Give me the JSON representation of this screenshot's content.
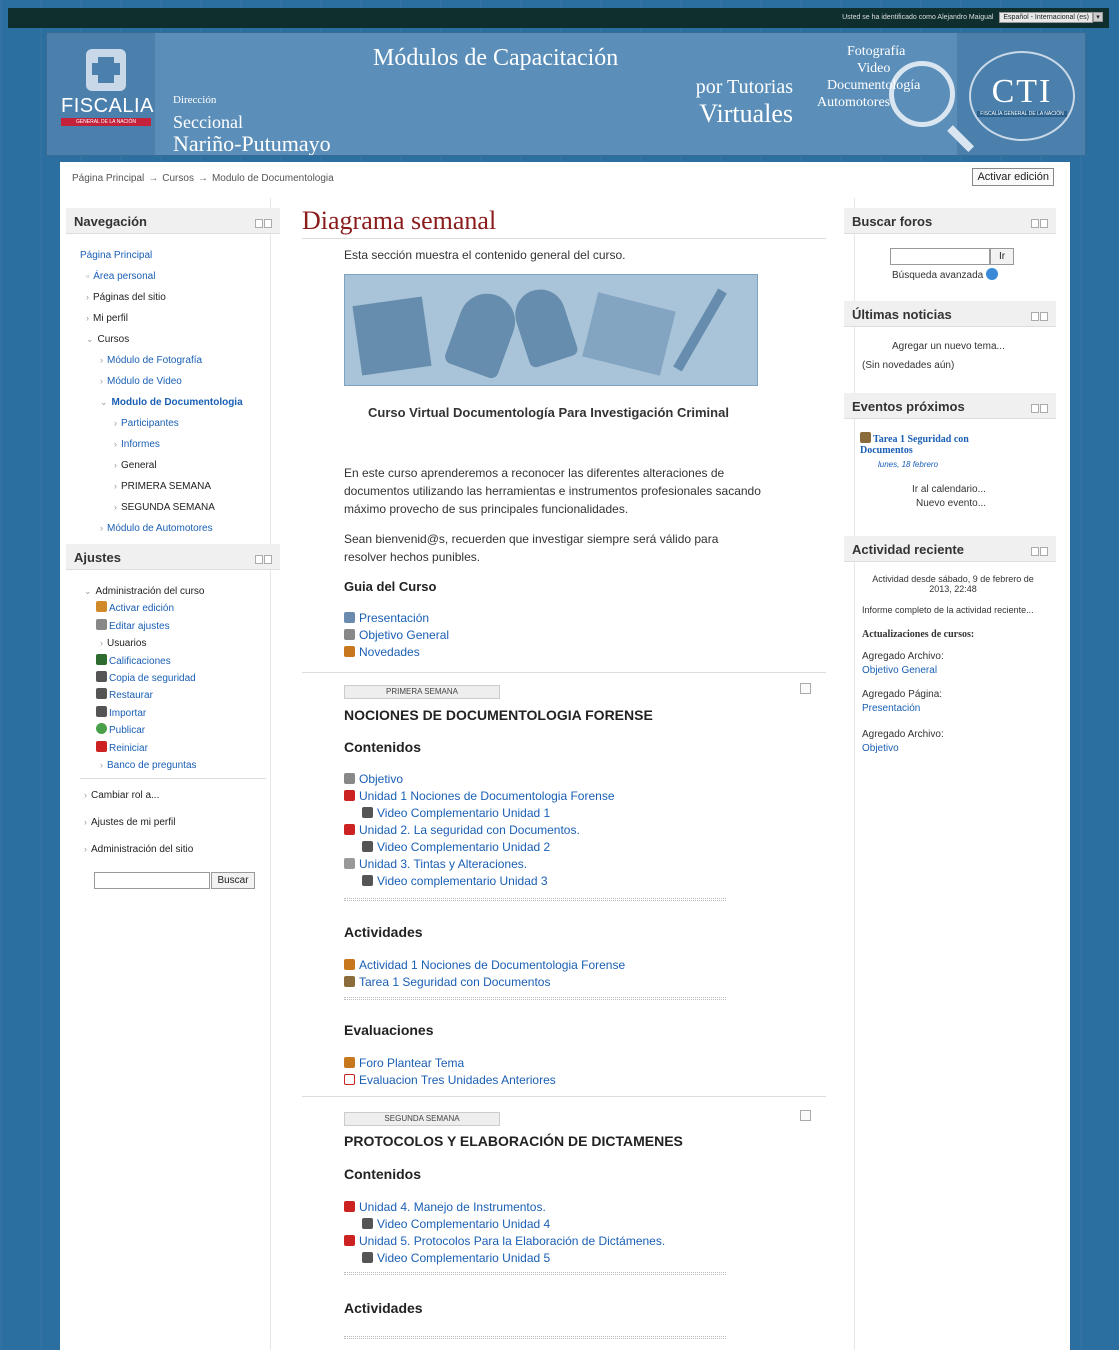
{
  "topbar": {
    "login_text": "Usted se ha identificado como Alejandro Maigual",
    "language": "Español - Internacional (es)"
  },
  "banner": {
    "org": "FISCALIA",
    "org_sub": "GENERAL DE LA NACIÓN",
    "dir_line1": "Dirección",
    "dir_line2": "Seccional",
    "dir_line3": "Nariño-Putumayo",
    "title_line1": "Módulos de Capacitación",
    "title_line2": "por Tutorias",
    "title_line3": "Virtuales",
    "right_lines": [
      "Fotografía",
      "Video",
      "Documentología",
      "Automotores"
    ],
    "cti": "CTI",
    "cti_sub": "FISCALÍA GENERAL DE LA NACIÓN"
  },
  "breadcrumb": [
    "Página Principal",
    "Cursos",
    "Modulo de Documentologia"
  ],
  "edit_button": "Activar edición",
  "nav": {
    "title": "Navegación",
    "items": [
      {
        "label": "Página Principal",
        "level": 0,
        "link": true
      },
      {
        "label": "Área personal",
        "level": 1,
        "link": true
      },
      {
        "label": "Páginas del sitio",
        "level": 1,
        "link": false
      },
      {
        "label": "Mi perfil",
        "level": 1,
        "link": false
      },
      {
        "label": "Cursos",
        "level": 1,
        "link": false
      },
      {
        "label": "Módulo de Fotografía",
        "level": 2,
        "link": true
      },
      {
        "label": "Módulo de Video",
        "level": 2,
        "link": true
      },
      {
        "label": "Modulo de Documentologia",
        "level": 2,
        "link": true
      },
      {
        "label": "Participantes",
        "level": 3,
        "link": true
      },
      {
        "label": "Informes",
        "level": 3,
        "link": true
      },
      {
        "label": "General",
        "level": 3,
        "link": false
      },
      {
        "label": "PRIMERA SEMANA",
        "level": 3,
        "link": false
      },
      {
        "label": "SEGUNDA SEMANA",
        "level": 3,
        "link": false
      },
      {
        "label": "Módulo de Automotores",
        "level": 2,
        "link": true
      }
    ]
  },
  "settings": {
    "title": "Ajustes",
    "admin": "Administración del curso",
    "items": [
      "Activar edición",
      "Editar ajustes",
      "Usuarios",
      "Calificaciones",
      "Copia de seguridad",
      "Restaurar",
      "Importar",
      "Publicar",
      "Reiniciar",
      "Banco de preguntas"
    ],
    "links": [
      "Cambiar rol a...",
      "Ajustes de mi perfil",
      "Administración del sitio"
    ],
    "search_button": "Buscar"
  },
  "main": {
    "title": "Diagrama semanal",
    "intro": "Esta sección muestra el contenido general del curso.",
    "course_title": "Curso Virtual Documentología Para Investigación Criminal",
    "desc1_l1": "En este curso aprenderemos a reconocer las diferentes alteraciones de",
    "desc1_l2": "documentos utilizando las herramientas e instrumentos profesionales sacando",
    "desc1_l3": "máximo provecho de sus principales funcionalidades.",
    "desc2_l1": "Sean bienvenid@s, recuerden que investigar siempre será válido para",
    "desc2_l2": "resolver hechos punibles.",
    "guide_title": "Guia del Curso",
    "guide_items": [
      "Presentación",
      "Objetivo General",
      "Novedades"
    ],
    "week1": {
      "tag": "PRIMERA SEMANA",
      "title": "NOCIONES DE DOCUMENTOLOGIA FORENSE",
      "contenidos": "Contenidos",
      "content_items": [
        "Objetivo",
        "Unidad 1 Nociones de Documentologia Forense",
        "Video Complementario Unidad 1",
        "Unidad 2. La seguridad con Documentos.",
        "Video Complementario Unidad 2",
        "Unidad 3. Tintas y Alteraciones.",
        "Video complementario Unidad 3"
      ],
      "actividades": "Actividades",
      "activity_items": [
        "Actividad 1 Nociones de Documentologia Forense",
        "Tarea 1 Seguridad con Documentos"
      ],
      "evaluaciones": "Evaluaciones",
      "eval_items": [
        "Foro Plantear Tema",
        "Evaluacion Tres Unidades Anteriores"
      ]
    },
    "week2": {
      "tag": "SEGUNDA SEMANA",
      "title": "PROTOCOLOS Y ELABORACIÓN DE DICTAMENES",
      "contenidos": "Contenidos",
      "content_items": [
        "Unidad 4. Manejo de Instrumentos.",
        "Video Complementario Unidad 4",
        "Unidad 5. Protocolos Para la Elaboración de Dictámenes.",
        "Video Complementario Unidad 5"
      ],
      "actividades": "Actividades"
    }
  },
  "right": {
    "search_forums": "Buscar foros",
    "go": "Ir",
    "advanced": "Búsqueda avanzada",
    "news_title": "Últimas noticias",
    "add_topic": "Agregar un nuevo tema...",
    "no_news": "(Sin novedades aún)",
    "events_title": "Eventos próximos",
    "event_name_l1": "Tarea 1 Seguridad con",
    "event_name_l2": "Documentos",
    "event_date": "lunes, 18 febrero",
    "calendar": "Ir al calendario...",
    "new_event": "Nuevo evento...",
    "recent_title": "Actividad reciente",
    "recent_since_l1": "Actividad desde sábado, 9 de febrero de",
    "recent_since_l2": "2013, 22:48",
    "full_report": "Informe completo de la actividad reciente...",
    "updates": "Actualizaciones de cursos:",
    "u1_label": "Agregado Archivo:",
    "u1_link": "Objetivo General",
    "u2_label": "Agregado Página:",
    "u2_link": "Presentación",
    "u3_label": "Agregado Archivo:",
    "u3_link": "Objetivo"
  }
}
